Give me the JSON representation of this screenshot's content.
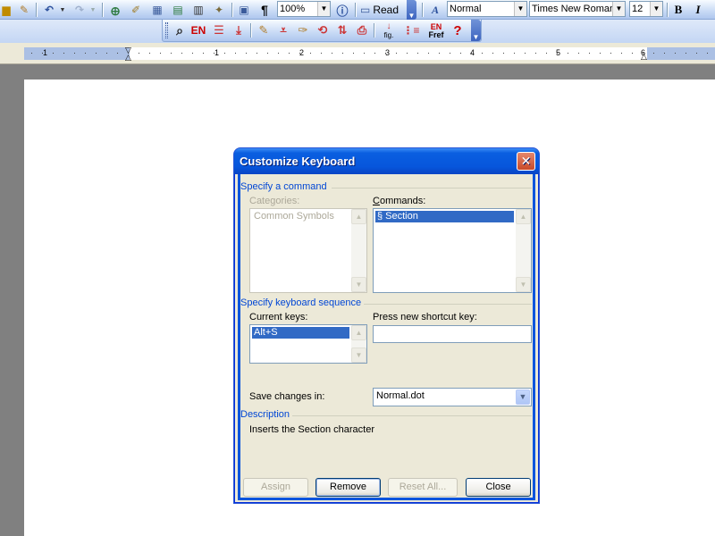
{
  "toolbar": {
    "zoom": "100%",
    "read_label": "Read",
    "style": "Normal",
    "font": "Times New Roman",
    "font_size": "12",
    "bold_glyph": "B",
    "italic_glyph": "I",
    "pilcrow": "¶",
    "en_label": "EN",
    "en_fref_top": "EN",
    "en_fref_bottom": "Fref",
    "fig_label": "fig.",
    "help_glyph": "?"
  },
  "ruler": {
    "numbers": [
      "1",
      "1",
      "2",
      "3",
      "4",
      "5",
      "6"
    ]
  },
  "dialog": {
    "title": "Customize Keyboard",
    "close_glyph": "✕",
    "specify_command": "Specify a command",
    "categories_label": "Categories:",
    "categories_items": [
      "Common Symbols"
    ],
    "commands_label": "Commands:",
    "commands_items": [
      "§   Section"
    ],
    "specify_keyboard": "Specify keyboard sequence",
    "current_keys_label": "Current keys:",
    "current_keys_items": [
      "Alt+S"
    ],
    "press_new_label": "Press new shortcut key:",
    "press_new_value": "",
    "save_changes_label": "Save changes in:",
    "save_changes_value": "Normal.dot",
    "description_heading": "Description",
    "description_text": "Inserts the Section character",
    "buttons": {
      "assign": "Assign",
      "remove": "Remove",
      "reset_all": "Reset All...",
      "close": "Close"
    }
  },
  "colors": {
    "title_bar": "#0756dc",
    "section_text": "#0046d5",
    "selection": "#316ac5"
  }
}
